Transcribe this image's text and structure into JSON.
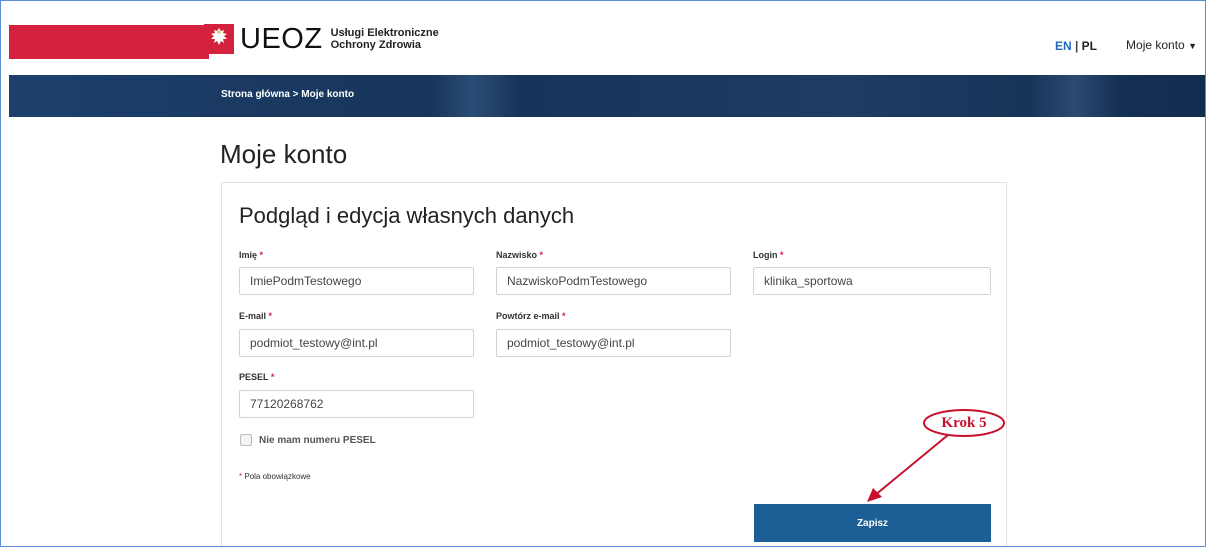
{
  "header": {
    "brand": "UEOZ",
    "brand_sub_line1": "Usługi Elektroniczne",
    "brand_sub_line2": "Ochrony Zdrowia",
    "lang_en": "EN",
    "lang_sep": "|",
    "lang_pl": "PL",
    "account_label": "Moje konto"
  },
  "breadcrumb": "Strona główna > Moje konto",
  "page_title": "Moje konto",
  "form": {
    "title": "Podgląd i edycja własnych danych",
    "required_mark": "*",
    "fields": {
      "first_name": {
        "label": "Imię",
        "value": "ImiePodmTestowego"
      },
      "last_name": {
        "label": "Nazwisko",
        "value": "NazwiskoPodmTestowego"
      },
      "login": {
        "label": "Login",
        "value": "klinika_sportowa"
      },
      "email": {
        "label": "E-mail",
        "value": "podmiot_testowy@int.pl"
      },
      "email_repeat": {
        "label": "Powtórz e-mail",
        "value": "podmiot_testowy@int.pl"
      },
      "pesel": {
        "label": "PESEL",
        "value": "77120268762"
      }
    },
    "no_pesel_label": "Nie mam numeru PESEL",
    "no_pesel_checked": false,
    "required_note": "Pola obowiązkowe",
    "save_label": "Zapisz"
  },
  "annotation": {
    "label": "Krok 5",
    "color": "#c8102e"
  },
  "colors": {
    "brand_red": "#d4213d",
    "nav_blue": "#163459",
    "button_blue": "#1b5f96",
    "link_blue": "#1f6bbf"
  }
}
